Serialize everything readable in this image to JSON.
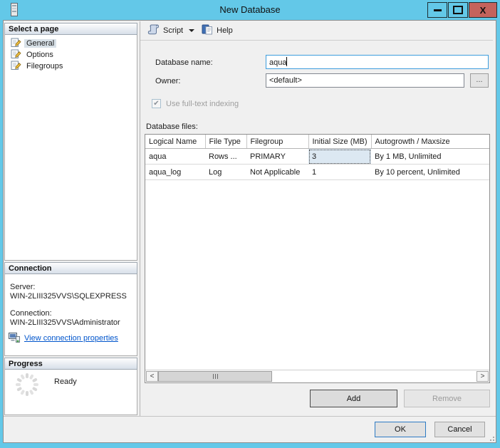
{
  "window": {
    "title": "New Database",
    "close_glyph": "X"
  },
  "sidebar": {
    "select_page": {
      "header": "Select a page",
      "items": [
        {
          "label": "General"
        },
        {
          "label": "Options"
        },
        {
          "label": "Filegroups"
        }
      ]
    },
    "connection": {
      "header": "Connection",
      "server_label": "Server:",
      "server_value": "WIN-2LIII325VVS\\SQLEXPRESS",
      "connection_label": "Connection:",
      "connection_value": "WIN-2LIII325VVS\\Administrator",
      "link_label": "View connection properties"
    },
    "progress": {
      "header": "Progress",
      "status": "Ready"
    }
  },
  "toolbar": {
    "script_label": "Script",
    "help_label": "Help"
  },
  "form": {
    "database_name_label": "Database name:",
    "database_name_value": "aqua",
    "owner_label": "Owner:",
    "owner_value": "<default>",
    "browse_label": "...",
    "fulltext_check": "✔",
    "fulltext_label": "Use full-text indexing",
    "files_label": "Database files:"
  },
  "table": {
    "columns": [
      "Logical Name",
      "File Type",
      "Filegroup",
      "Initial Size (MB)",
      "Autogrowth / Maxsize"
    ],
    "rows": [
      [
        "aqua",
        "Rows ...",
        "PRIMARY",
        "3",
        "By 1 MB, Unlimited"
      ],
      [
        "aqua_log",
        "Log",
        "Not Applicable",
        "1",
        "By 10 percent, Unlimited"
      ]
    ]
  },
  "scrollbar": {
    "left_arrow": "<",
    "right_arrow": ">"
  },
  "actions": {
    "add": "Add",
    "remove": "Remove",
    "ok": "OK",
    "cancel": "Cancel"
  },
  "colors": {
    "titlebar": "#63c8e8",
    "close_button": "#c4635c",
    "focus_border": "#3e9ddd",
    "ok_border": "#2e7bc4",
    "link": "#0055cc",
    "selected_cell_bg": "#dce8f2"
  }
}
